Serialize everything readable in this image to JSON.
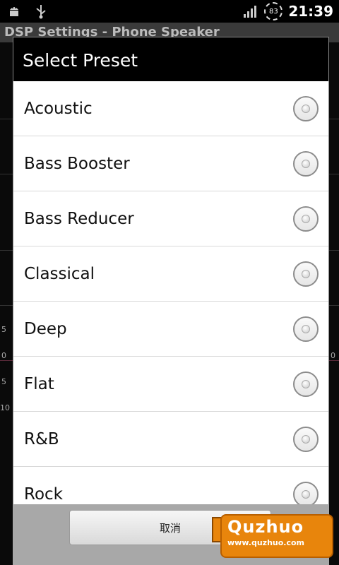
{
  "status_bar": {
    "battery_level": "83",
    "time": "21:39"
  },
  "background": {
    "title": "DSP Settings - Phone Speaker",
    "scale_labels": [
      "5",
      "0",
      "5",
      "10"
    ],
    "scale_labels_right": [
      "0"
    ]
  },
  "dialog": {
    "title": "Select Preset",
    "items": [
      {
        "label": "Acoustic",
        "selected": false
      },
      {
        "label": "Bass Booster",
        "selected": false
      },
      {
        "label": "Bass Reducer",
        "selected": false
      },
      {
        "label": "Classical",
        "selected": false
      },
      {
        "label": "Deep",
        "selected": false
      },
      {
        "label": "Flat",
        "selected": false
      },
      {
        "label": "R&B",
        "selected": false
      },
      {
        "label": "Rock",
        "selected": false
      }
    ],
    "cancel_label": "取消"
  },
  "watermark": {
    "name": "Quzhuo",
    "url": "www.quzhuo.com"
  },
  "colors": {
    "dialog_title_bg": "#000000",
    "list_bg": "#ffffff",
    "footer_bg": "#a8a8a8",
    "watermark": "#e8850c"
  }
}
